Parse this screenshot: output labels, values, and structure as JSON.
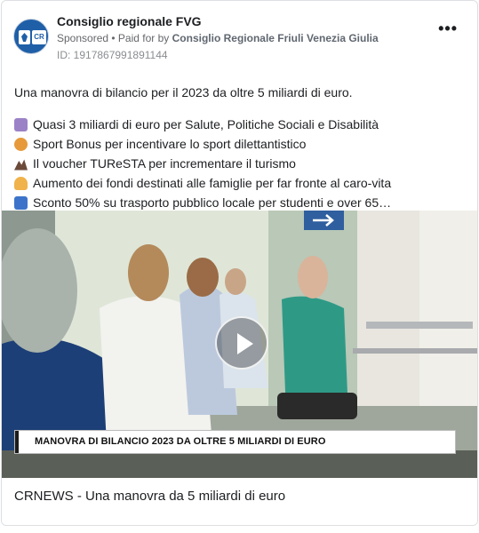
{
  "post": {
    "page_name": "Consiglio regionale FVG",
    "sponsored": "Sponsored",
    "separator": " • ",
    "paid_for_prefix": "Paid for by ",
    "paid_for_name": "Consiglio Regionale Friuli Venezia Giulia",
    "ad_id": "ID: 1917867991891144",
    "avatar_text": "CR",
    "more_label": "•••"
  },
  "body": {
    "intro": "Una manovra di bilancio per il 2023 da oltre 5 miliardi di euro.",
    "lines": [
      {
        "icon": "book-icon",
        "text": "Quasi 3 miliardi di euro per Salute, Politiche Sociali e Disabilità"
      },
      {
        "icon": "rugby-ball-icon",
        "text": "Sport Bonus per incentivare lo sport dilettantistico"
      },
      {
        "icon": "mountain-icon",
        "text": "Il voucher TUReSTA per incrementare il turismo"
      },
      {
        "icon": "family-icon",
        "text": "Aumento dei fondi destinati alle famiglie per far fronte al caro-vita"
      },
      {
        "icon": "bus-icon",
        "text": "Sconto 50% su trasporto pubblico locale per studenti e over 65…"
      }
    ]
  },
  "media": {
    "caption": "MANOVRA DI BILANCIO 2023 DA OLTRE 5 MILIARDI DI EURO",
    "play_icon": "play-icon"
  },
  "footer": {
    "title": "CRNEWS - Una manovra da 5 miliardi di euro"
  }
}
